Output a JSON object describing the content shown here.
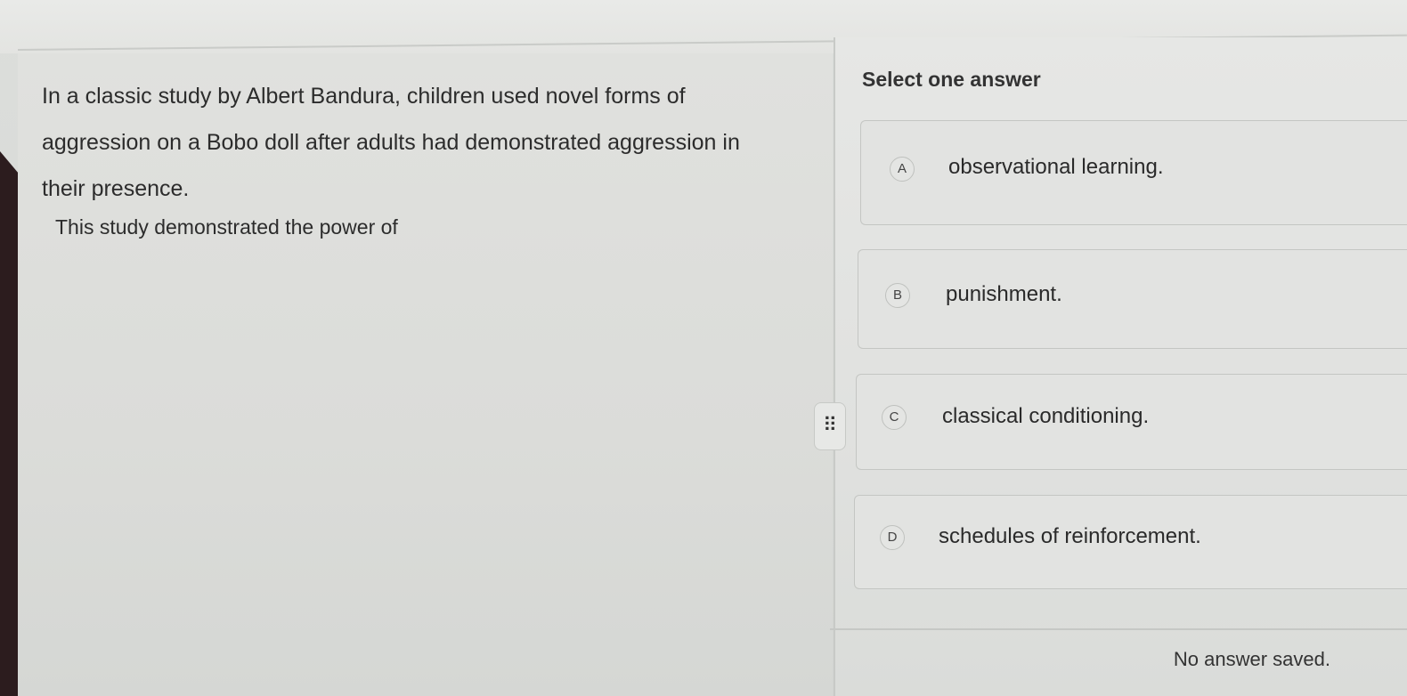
{
  "question": {
    "text": "In a classic study by Albert Bandura, children used novel forms of aggression on a Bobo doll after adults had demonstrated aggression in their presence.",
    "prompt": "This study demonstrated the power of"
  },
  "answers": {
    "title": "Select one answer",
    "options": [
      {
        "letter": "A",
        "label": "observational learning."
      },
      {
        "letter": "B",
        "label": "punishment."
      },
      {
        "letter": "C",
        "label": "classical conditioning."
      },
      {
        "letter": "D",
        "label": "schedules of reinforcement."
      }
    ]
  },
  "drag_handle": {
    "glyph": "⠿"
  },
  "footer": {
    "status": "No answer saved."
  }
}
